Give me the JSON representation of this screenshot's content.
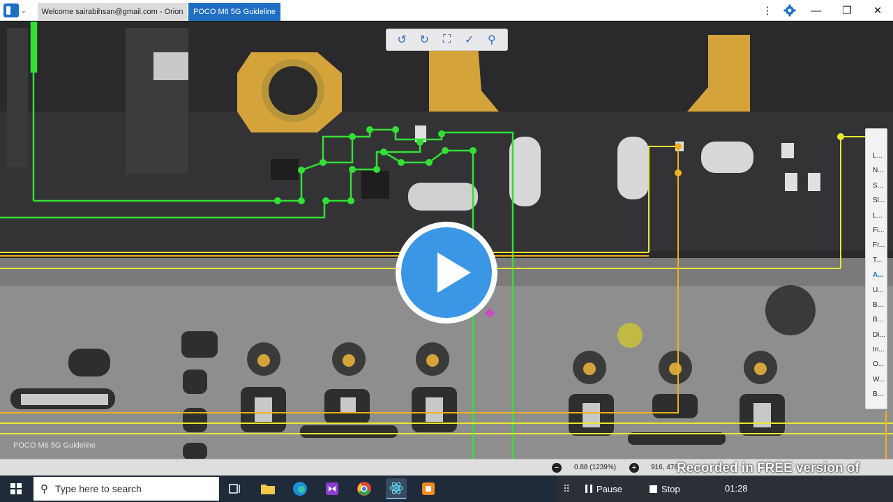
{
  "window": {
    "tabs": [
      {
        "label": "Welcome sairabihsan@gmail.com - Orion"
      },
      {
        "label": "POCO M6 5G Guideline"
      }
    ],
    "controls": {
      "more": "⋮",
      "minimize": "—",
      "maximize": "❐",
      "close": "✕"
    }
  },
  "board": {
    "silkscreen_label": "POCO M6 5G Guideline",
    "side_list": [
      "L...",
      "N...",
      "S...",
      "Sl...",
      "L...",
      "Fi...",
      "Fr...",
      "T...",
      "A...",
      "U...",
      "B...",
      "B...",
      "Di...",
      "In...",
      "O...",
      "W...",
      "B..."
    ],
    "side_list_active_index": 8
  },
  "viewer_toolbar": {
    "icons": [
      "rotate-left-icon",
      "rotate-right-icon",
      "fit-screen-icon",
      "select-tool-icon",
      "search-icon"
    ]
  },
  "status": {
    "zoom": "0.88 (1239%)",
    "coords": "916, 476"
  },
  "recorder": {
    "watermark": "Recorded in FREE version of Icecream Screen Recorder",
    "pause_label": "Pause",
    "stop_label": "Stop",
    "time": "01:28"
  },
  "taskbar": {
    "search_placeholder": "Type here to search"
  },
  "colors": {
    "accent": "#1f6fc2",
    "trace_green": "#33e033",
    "trace_yellow": "#e8e830",
    "trace_orange": "#f0b020",
    "play_blue": "#3b97e6"
  }
}
